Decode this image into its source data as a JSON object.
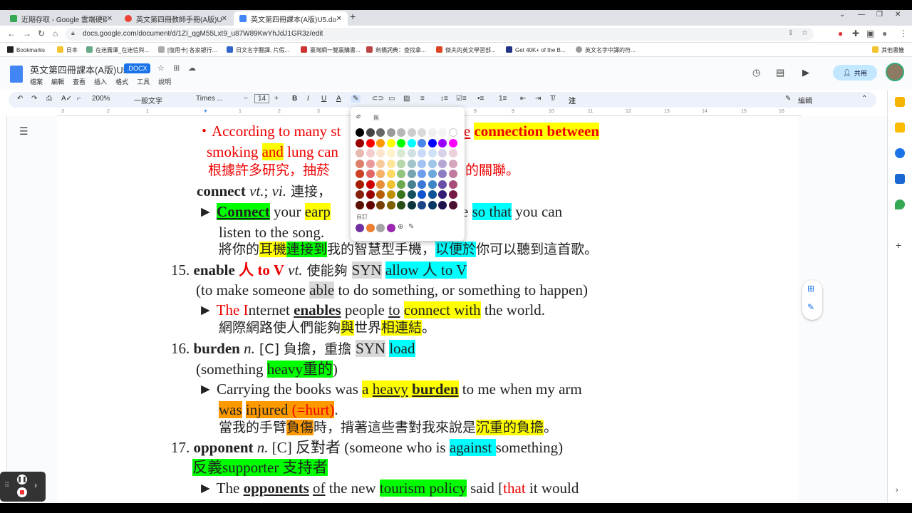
{
  "browser": {
    "tabs": [
      {
        "label": "近期存取 - Google 雲端硬碟",
        "color": "#34a853"
      },
      {
        "label": "英文第四冊教師手冊(A版)U5.pdf",
        "color": "#ea4335"
      },
      {
        "label": "英文第四冊課本(A版)U5.docx -",
        "color": "#4285f4"
      }
    ],
    "url": "docs.google.com/document/d/1ZI_qgM55Lxt9_u87W89KwYhJdJ1GR3z/edit",
    "bookmarks": [
      "Bookmarks",
      "日本",
      "在迷霧澤_在迷信與...",
      "[復用卡] 各家銀行...",
      "日文名字翻譯, 片假...",
      "臺灣網一雙贏購書...",
      "劍橋詞典：查找拿...",
      "傑夫的英文學習部...",
      "Get 40K+ of the B...",
      "英文名字中譯的符..."
    ],
    "other_bookmarks": "其他書籤"
  },
  "doc": {
    "title": "英文第四冊課本(A版)U5",
    "badge": ".DOCX",
    "menus": [
      "檔案",
      "編輯",
      "查看",
      "插入",
      "格式",
      "工具",
      "說明"
    ],
    "share": "共用",
    "toolbar": {
      "zoom": "200%",
      "style": "一般文字",
      "font": "Times ...",
      "size": "14",
      "edit_mode": "編輯",
      "annot": "注"
    }
  },
  "ruler": [
    "3",
    "2",
    "1",
    "1",
    "2",
    "3",
    "4",
    "5",
    "6",
    "7",
    "8",
    "9",
    "10",
    "11",
    "12",
    "13",
    "14",
    "15",
    "16",
    "17",
    "18"
  ],
  "palette": {
    "none_label": "無",
    "custom_label": "自訂",
    "rows": [
      [
        "#000000",
        "#434343",
        "#666666",
        "#999999",
        "#b7b7b7",
        "#cccccc",
        "#d9d9d9",
        "#efefef",
        "#f3f3f3",
        "#ffffff"
      ],
      [
        "#980000",
        "#ff0000",
        "#ff9900",
        "#ffff00",
        "#00ff00",
        "#00ffff",
        "#4a86e8",
        "#0000ff",
        "#9900ff",
        "#ff00ff"
      ],
      [
        "#e6b8af",
        "#f4cccc",
        "#fce5cd",
        "#fff2cc",
        "#d9ead3",
        "#d0e0e3",
        "#c9daf8",
        "#cfe2f3",
        "#d9d2e9",
        "#ead1dc"
      ],
      [
        "#dd7e6b",
        "#ea9999",
        "#f9cb9c",
        "#ffe599",
        "#b6d7a8",
        "#a2c4c9",
        "#a4c2f4",
        "#9fc5e8",
        "#b4a7d6",
        "#d5a6bd"
      ],
      [
        "#cc4125",
        "#e06666",
        "#f6b26b",
        "#ffd966",
        "#93c47d",
        "#76a5af",
        "#6d9eeb",
        "#6fa8dc",
        "#8e7cc3",
        "#c27ba0"
      ],
      [
        "#a61c00",
        "#cc0000",
        "#e69138",
        "#f1c232",
        "#6aa84f",
        "#45818e",
        "#3c78d8",
        "#3d85c6",
        "#674ea7",
        "#a64d79"
      ],
      [
        "#85200c",
        "#990000",
        "#b45f06",
        "#bf9000",
        "#38761d",
        "#134f5c",
        "#1155cc",
        "#0b5394",
        "#351c75",
        "#741b47"
      ],
      [
        "#5b0f00",
        "#660000",
        "#783f04",
        "#7f6000",
        "#274e13",
        "#0c343d",
        "#1c4587",
        "#073763",
        "#20124d",
        "#4c1130"
      ]
    ],
    "custom": [
      "#7030a0",
      "#ed7d31",
      "#a5a5a5",
      "#9c27b0"
    ]
  },
  "content": {
    "l1a": "・According to many st",
    "l1b": "lose",
    "l1c": "connection between",
    "l2a": "smoking ",
    "l2b": "and",
    "l2c": " lung can",
    "l3a": "根據許多研究，抽菸",
    "l3b": "的關聯。",
    "l4a": "connect ",
    "l4b": "vt.",
    "l4c": "; ",
    "l4d": "vi.",
    "l4e": " 連接，",
    "l5a": "► ",
    "l5b": "Connect",
    "l5c": " your ",
    "l5d": "earp",
    "l5e": "artphone ",
    "l5f": "so that",
    "l5g": " you can",
    "l6": "listen to the song.",
    "l7a": "將你的",
    "l7b": "耳機",
    "l7c": "連接到",
    "l7d": "我的智慧型手機，",
    "l7e": "以便於",
    "l7f": "你可以聽到這首歌。",
    "l8a": "15. ",
    "l8b": "enable ",
    "l8c": "人 to V",
    "l8d": " vt.",
    "l8e": " 使能夠  ",
    "l8f": "SYN",
    "l8g": " ",
    "l8h": "allow 人 to V",
    "l9a": "(to make someone ",
    "l9b": "able",
    "l9c": " to do something, or something to happen)",
    "l10a": "► ",
    "l10b": "The I",
    "l10c": "nternet ",
    "l10d": "enables",
    "l10e": " people ",
    "l10f": "to",
    "l10g": " ",
    "l10h": "connect with",
    "l10i": " the world.",
    "l11a": "網際網路使人們能夠",
    "l11b": "與",
    "l11c": "世界",
    "l11d": "相連結",
    "l11e": "。",
    "l12a": "16. ",
    "l12b": "burden ",
    "l12c": "n.",
    "l12d": " [C] 負擔，重擔  ",
    "l12e": "SYN",
    "l12f": " ",
    "l12g": "load",
    "l13a": "(something ",
    "l13b": "heavy重的",
    "l13c": ")",
    "l14a": "► Carrying the books was ",
    "l14b": "a ",
    "l14c": "heavy",
    "l14d": " ",
    "l14e": "burden",
    "l14f": " to me when my arm",
    "l15a": "was",
    "l15b": " ",
    "l15c": "injured ",
    "l15d": "(=hurt)",
    "l15e": ".",
    "l16a": "當我的手臂",
    "l16b": "負傷",
    "l16c": "時，揹著這些書對我來說是",
    "l16d": "沉重的負擔",
    "l16e": "。",
    "l17a": "17. ",
    "l17b": "opponent ",
    "l17c": "n.",
    "l17d": " [C] 反對者  (someone who is ",
    "l17e": "against ",
    "l17f": "something)",
    "l18": "反義supporter 支持者",
    "l19a": "► The ",
    "l19b": "opponents",
    "l19c": " ",
    "l19d": "of",
    "l19e": " the new ",
    "l19f": "tourism policy",
    "l19g": " said [",
    "l19h": "that",
    "l19i": " it would"
  }
}
